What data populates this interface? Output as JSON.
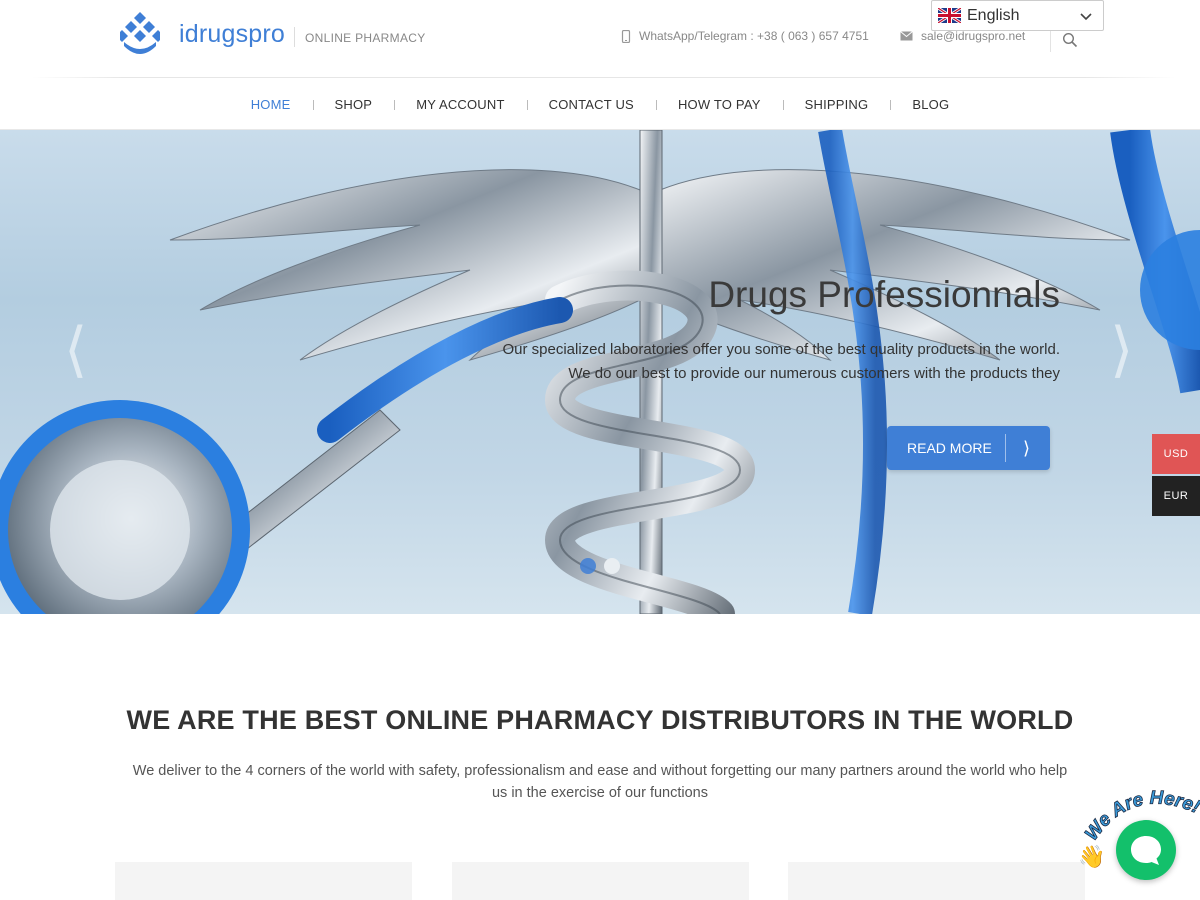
{
  "header": {
    "brand": "idrugspro",
    "tagline": "ONLINE PHARMACY",
    "phone": "WhatsApp/Telegram : +38 ( 063 ) 657 4751",
    "email": "sale@idrugspro.net",
    "language": "English"
  },
  "nav": {
    "items": [
      "HOME",
      "SHOP",
      "MY ACCOUNT",
      "CONTACT US",
      "HOW TO PAY",
      "SHIPPING",
      "BLOG"
    ],
    "active": "HOME"
  },
  "hero": {
    "title": "Drugs Professionnals",
    "text": "Our specialized laboratories offer you some of the best quality products in the world. We do our best to provide our numerous customers with the products they",
    "button": "READ MORE",
    "button_arrow": "⟩",
    "prev": "⟨",
    "next": "⟩",
    "slide_count": 2,
    "active_slide": 1
  },
  "currency": {
    "options": [
      "USD",
      "EUR"
    ]
  },
  "main": {
    "title": "WE ARE THE BEST ONLINE PHARMACY DISTRIBUTORS IN THE WORLD",
    "text": "We deliver to the 4 corners of the world with safety, professionalism and ease and without forgetting our many partners around the world who help us in the exercise of our functions"
  },
  "chat": {
    "label": "We Are Here!",
    "icon": "chat-bubble-icon",
    "wave": "👋"
  },
  "colors": {
    "accent": "#3f7fd6",
    "usd": "#e05555",
    "eur": "#222222",
    "chat": "#13c06b"
  }
}
